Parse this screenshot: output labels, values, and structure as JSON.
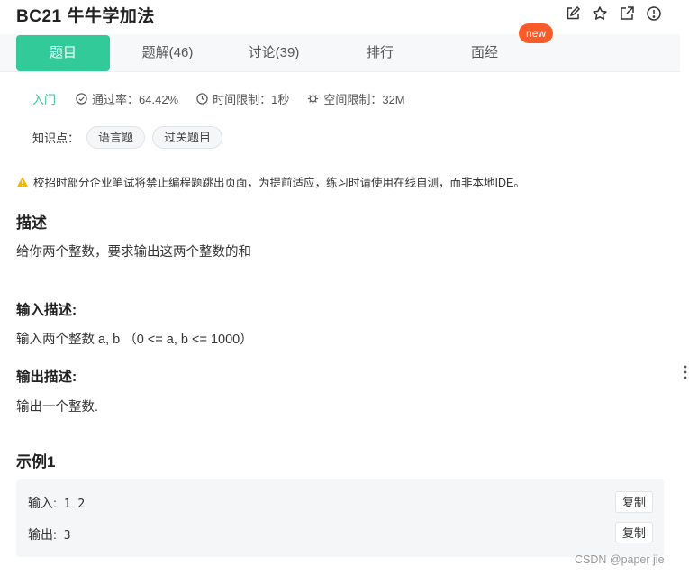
{
  "header": {
    "title": "BC21  牛牛学加法",
    "icons": [
      "edit-icon",
      "star-icon",
      "share-icon",
      "info-icon"
    ]
  },
  "tabs": [
    {
      "label": "题目"
    },
    {
      "label": "题解(46)"
    },
    {
      "label": "讨论(39)"
    },
    {
      "label": "排行"
    },
    {
      "label": "面经"
    }
  ],
  "new_badge": "new",
  "meta": {
    "level": "入门",
    "pass_rate": "通过率：64.42%",
    "time_limit": "时间限制：1秒",
    "space_limit": "空间限制：32M"
  },
  "knowledge": {
    "label": "知识点：",
    "tags": [
      "语言题",
      "过关题目"
    ]
  },
  "warning": "校招时部分企业笔试将禁止编程题跳出页面，为提前适应，练习时请使用在线自测，而非本地IDE。",
  "description": {
    "heading": "描述",
    "text": "给你两个整数，要求输出这两个整数的和"
  },
  "input_desc": {
    "heading": "输入描述:",
    "text": "输入两个整数 a, b （0 <= a, b <= 1000）"
  },
  "output_desc": {
    "heading": "输出描述:",
    "text": "输出一个整数."
  },
  "example": {
    "heading": "示例1",
    "input_label": "输入:",
    "input_value": "1 2",
    "output_label": "输出:",
    "output_value": "3",
    "copy_label": "复制"
  },
  "watermark": "CSDN @paper jie",
  "colors": {
    "accent": "#32ca99",
    "badge": "#fa5b28",
    "warning": "#f5b400"
  }
}
